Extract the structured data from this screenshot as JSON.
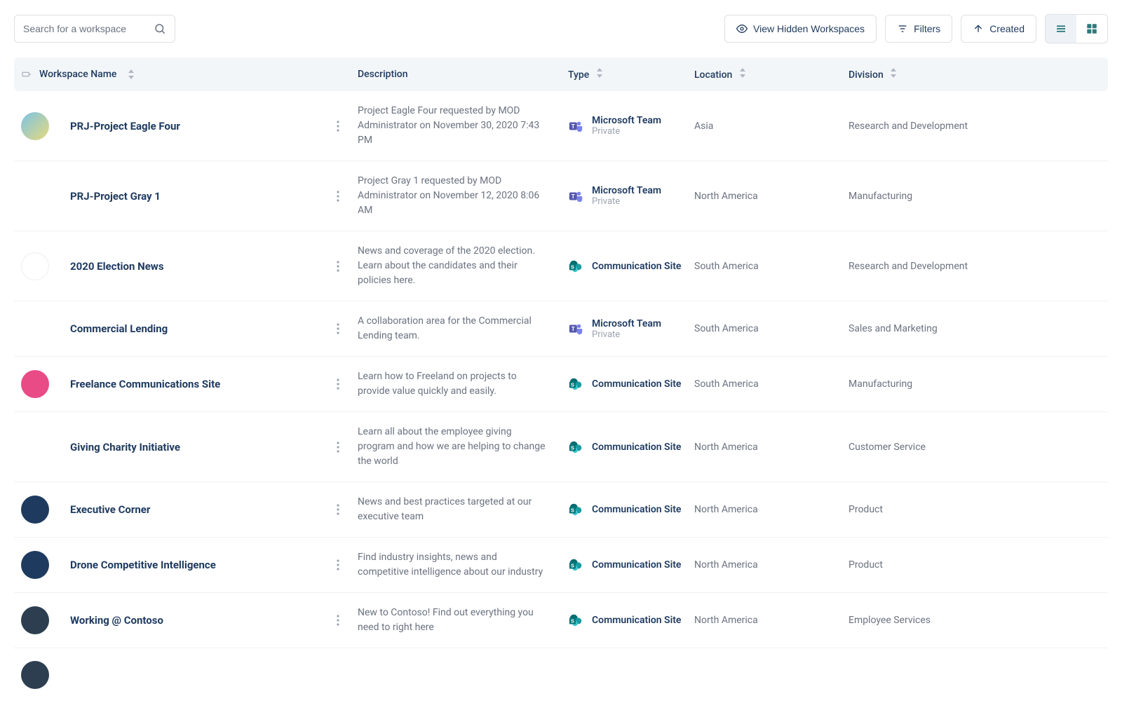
{
  "search": {
    "placeholder": "Search for a workspace"
  },
  "toolbar": {
    "view_hidden": "View Hidden Workspaces",
    "filters": "Filters",
    "created": "Created"
  },
  "columns": {
    "name": "Workspace Name",
    "description": "Description",
    "type": "Type",
    "location": "Location",
    "division": "Division"
  },
  "rows": [
    {
      "icon_class": "ic-board",
      "name": "PRJ-Project Eagle Four",
      "description": "Project Eagle Four requested by MOD Administrator on November 30, 2020 7:43 PM",
      "type": "Microsoft Team",
      "type_sub": "Private",
      "type_icon": "teams",
      "location": "Asia",
      "division": "Research and Development"
    },
    {
      "icon_class": "ic-bulb",
      "name": "PRJ-Project Gray 1",
      "description": "Project Gray 1 requested by MOD Administrator on November 12, 2020 8:06 AM",
      "type": "Microsoft Team",
      "type_sub": "Private",
      "type_icon": "teams",
      "location": "North America",
      "division": "Manufacturing"
    },
    {
      "icon_class": "ic-news",
      "name": "2020 Election News",
      "description": "News and coverage of the 2020 election. Learn about the candidates and their policies here.",
      "type": "Communication Site",
      "type_sub": "",
      "type_icon": "sharepoint",
      "location": "South America",
      "division": "Research and Development"
    },
    {
      "icon_class": "ic-cycle",
      "name": "Commercial Lending",
      "description": "A collaboration area for the Commercial Lending team.",
      "type": "Microsoft Team",
      "type_sub": "Private",
      "type_icon": "teams",
      "location": "South America",
      "division": "Sales and Marketing"
    },
    {
      "icon_class": "ic-thumb",
      "name": "Freelance Communications Site",
      "description": "Learn how to Freeland on projects to provide value quickly and easily.",
      "type": "Communication Site",
      "type_sub": "",
      "type_icon": "sharepoint",
      "location": "South America",
      "division": "Manufacturing"
    },
    {
      "icon_class": "ic-tree",
      "name": "Giving Charity Initiative",
      "description": "Learn all about the employee giving program and how we are helping to change the world",
      "type": "Communication Site",
      "type_sub": "",
      "type_icon": "sharepoint",
      "location": "North America",
      "division": "Customer Service"
    },
    {
      "icon_class": "ic-exec",
      "name": "Executive Corner",
      "description": "News and best practices targeted at our executive team",
      "type": "Communication Site",
      "type_sub": "",
      "type_icon": "sharepoint",
      "location": "North America",
      "division": "Product"
    },
    {
      "icon_class": "ic-drone",
      "name": "Drone Competitive Intelligence",
      "description": "Find industry insights, news and competitive intelligence about our industry",
      "type": "Communication Site",
      "type_sub": "",
      "type_icon": "sharepoint",
      "location": "North America",
      "division": "Product"
    },
    {
      "icon_class": "ic-balls",
      "name": "Working @ Contoso",
      "description": "New to Contoso! Find out everything you need to right here",
      "type": "Communication Site",
      "type_sub": "",
      "type_icon": "sharepoint",
      "location": "North America",
      "division": "Employee Services"
    }
  ]
}
